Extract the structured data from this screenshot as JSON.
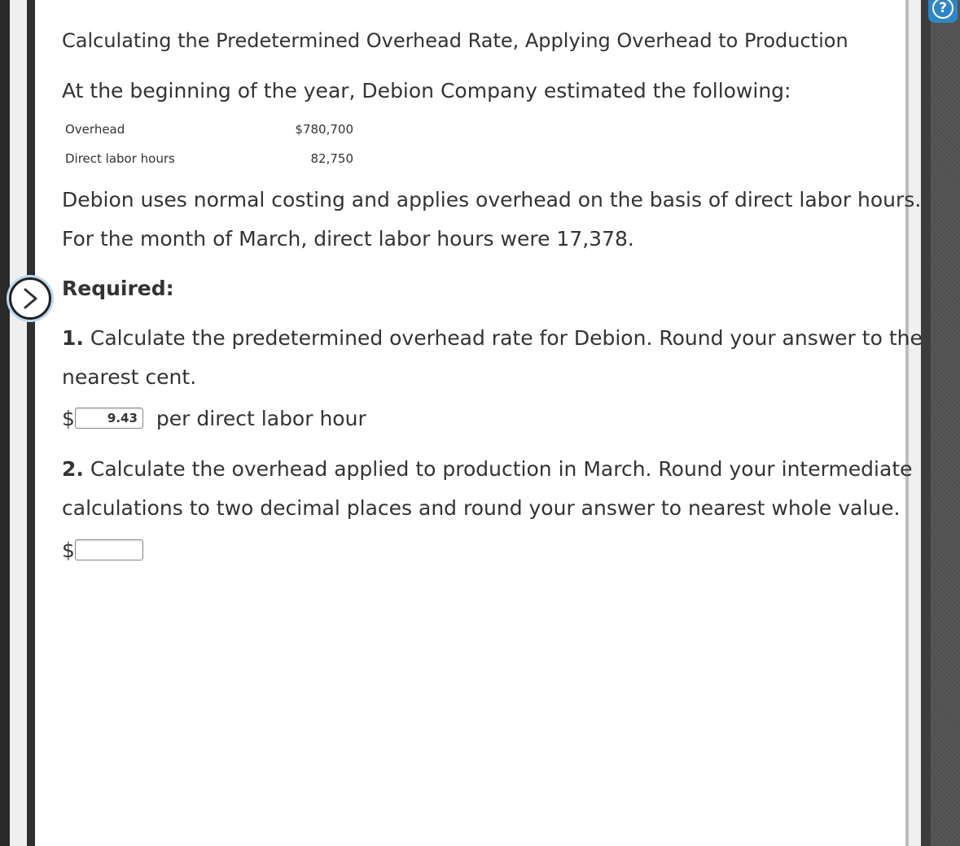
{
  "problem": {
    "title": "Calculating the Predetermined Overhead Rate, Applying Overhead to Production",
    "intro": "At the beginning of the year, Debion Company estimated the following:",
    "estimates": [
      {
        "label": "Overhead",
        "value": "$780,700"
      },
      {
        "label": "Direct labor hours",
        "value": "82,750"
      }
    ],
    "paragraph1": "Debion uses normal costing and applies overhead on the basis of direct labor hours.",
    "paragraph2": "For the month of March, direct labor hours were 17,378."
  },
  "required": {
    "heading": "Required:",
    "questions": [
      {
        "number": "1.",
        "line1": "Calculate the predetermined overhead rate for Debion. Round your answer to the",
        "line2": "nearest cent.",
        "currency": "$",
        "answer_value": "9.43",
        "unit": "per direct labor hour"
      },
      {
        "number": "2.",
        "line1": "Calculate the overhead applied to production in March. Round your intermediate",
        "line2": "calculations to two decimal places and round your answer to nearest whole value.",
        "currency": "$",
        "answer_value": ""
      }
    ]
  },
  "icons": {
    "help": "help-icon",
    "expand": "chevron-right-icon"
  },
  "colors": {
    "text": "#333333",
    "help_accent": "#2f86c6"
  }
}
